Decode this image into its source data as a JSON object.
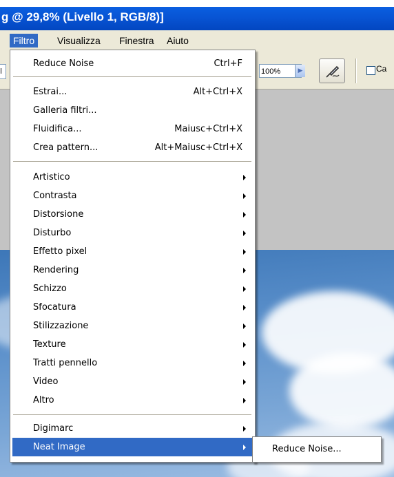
{
  "window": {
    "title_partial_top": "",
    "title": "g @ 29,8% (Livello 1, RGB/8)]"
  },
  "menubar": {
    "items": [
      {
        "label": "Filtro"
      },
      {
        "label": "Visualizza"
      },
      {
        "label": "Finestra"
      },
      {
        "label": "Aiuto"
      }
    ]
  },
  "options_bar": {
    "left_field_text": "l",
    "zoom_value": "100%",
    "checkbox_label": "Ca"
  },
  "filter_menu": {
    "items": [
      {
        "label": "Reduce Noise",
        "shortcut": "Ctrl+F"
      },
      {
        "label": "Estrai...",
        "shortcut": "Alt+Ctrl+X"
      },
      {
        "label": "Galleria filtri...",
        "shortcut": ""
      },
      {
        "label": "Fluidifica...",
        "shortcut": "Maiusc+Ctrl+X"
      },
      {
        "label": "Crea pattern...",
        "shortcut": "Alt+Maiusc+Ctrl+X"
      },
      {
        "label": "Artistico",
        "submenu": true
      },
      {
        "label": "Contrasta",
        "submenu": true
      },
      {
        "label": "Distorsione",
        "submenu": true
      },
      {
        "label": "Disturbo",
        "submenu": true
      },
      {
        "label": "Effetto pixel",
        "submenu": true
      },
      {
        "label": "Rendering",
        "submenu": true
      },
      {
        "label": "Schizzo",
        "submenu": true
      },
      {
        "label": "Sfocatura",
        "submenu": true
      },
      {
        "label": "Stilizzazione",
        "submenu": true
      },
      {
        "label": "Texture",
        "submenu": true
      },
      {
        "label": "Tratti pennello",
        "submenu": true
      },
      {
        "label": "Video",
        "submenu": true
      },
      {
        "label": "Altro",
        "submenu": true
      },
      {
        "label": "Digimarc",
        "submenu": true
      },
      {
        "label": "Neat Image",
        "submenu": true,
        "highlighted": true
      }
    ]
  },
  "neat_image_submenu": {
    "items": [
      {
        "label": "Reduce Noise..."
      }
    ]
  },
  "colors": {
    "title_bar": "#0854d4",
    "menu_highlight": "#316ac5",
    "menu_background": "#ffffff",
    "toolbar_background": "#ece9d8"
  }
}
